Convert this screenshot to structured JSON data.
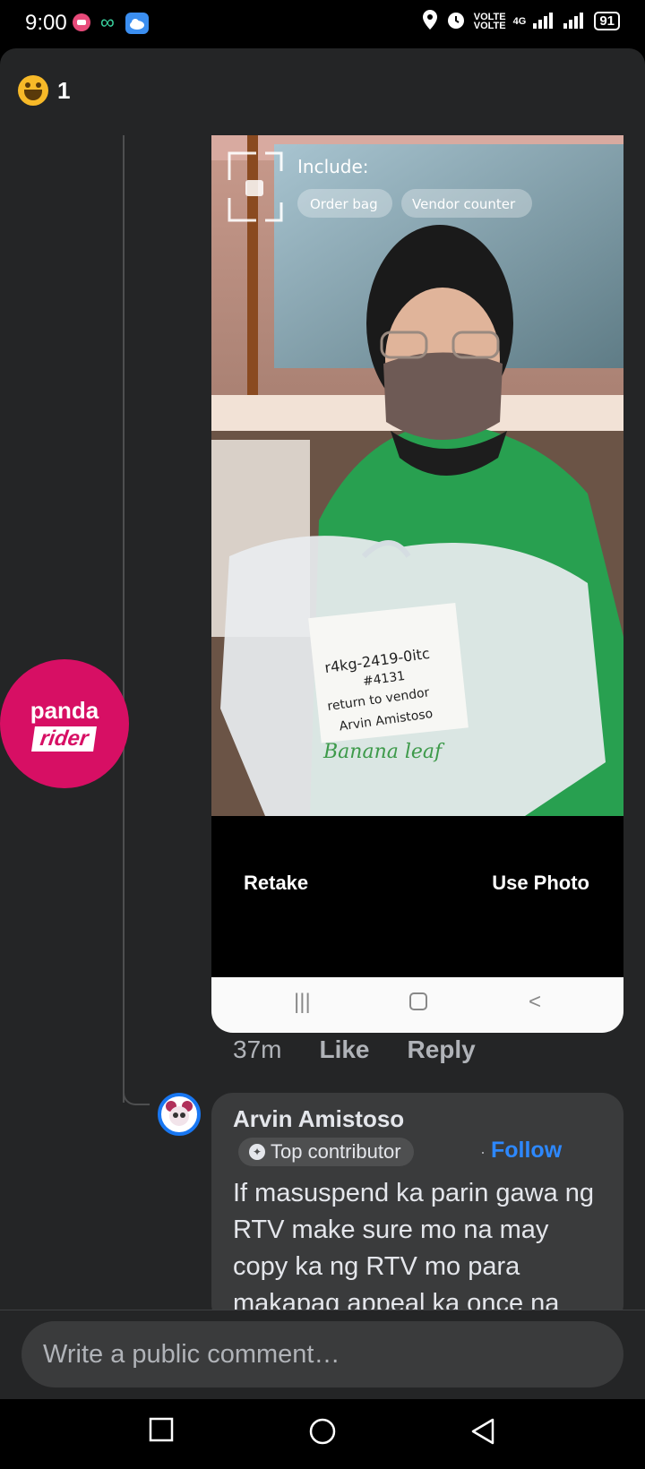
{
  "status_bar": {
    "time": "9:00",
    "network_label_1": "VOLTE",
    "network_label_2": "4G",
    "battery": "91",
    "icons": [
      "app-notification-icon",
      "infinity-icon",
      "cloud-icon",
      "location-icon",
      "alarm-icon",
      "signal-icon",
      "battery-icon"
    ]
  },
  "reaction": {
    "icon": "laugh-emoji-icon",
    "count": "1"
  },
  "page_avatar": {
    "line1": "panda",
    "line2": "rider"
  },
  "photo": {
    "overlay_title": "Include:",
    "overlay_chips": [
      "Order bag",
      "Vendor counter"
    ],
    "bag_note_lines": [
      "r4kg-2419-0itc",
      "#4131",
      "return to vendor",
      "Arvin Amistoso"
    ],
    "bag_print": "Banana leaf",
    "retake_label": "Retake",
    "use_photo_label": "Use Photo"
  },
  "comment_meta": {
    "time": "37m",
    "like": "Like",
    "reply": "Reply"
  },
  "reply_comment": {
    "author": "Arvin Amistoso",
    "badge": "Top contributor",
    "follow": "Follow",
    "text": "If masuspend ka parin gawa ng RTV make sure mo na may copy ka ng RTV mo para makapag appeal ka once na"
  },
  "composer": {
    "placeholder": "Write a public comment…"
  },
  "colors": {
    "background": "#242526",
    "bubble": "#3a3b3c",
    "accent": "#2d88ff",
    "brand": "#d70f64"
  }
}
